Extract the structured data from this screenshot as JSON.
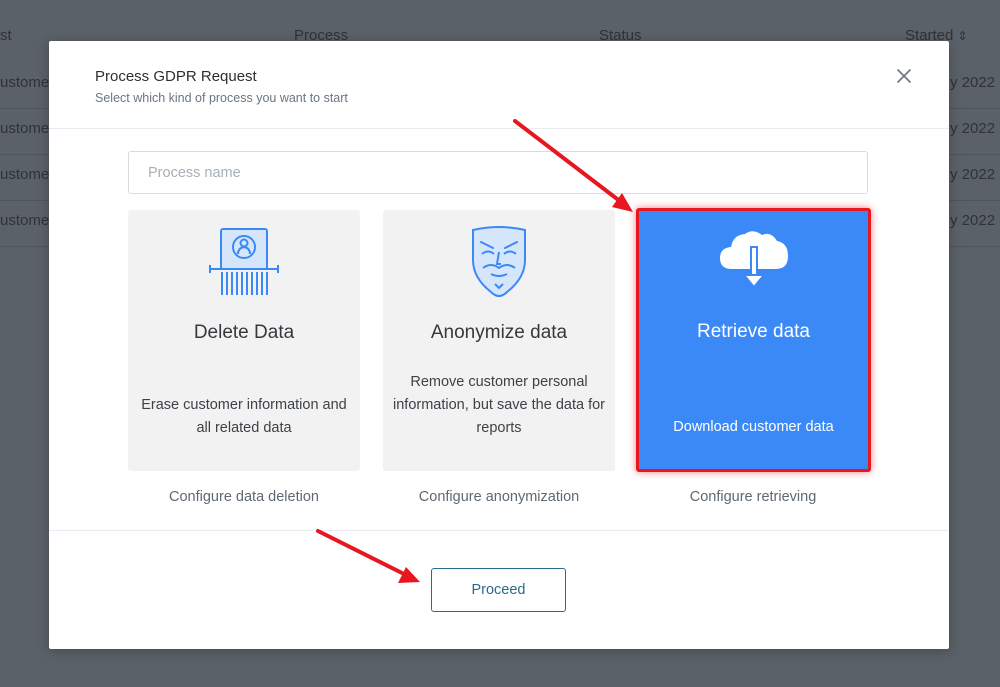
{
  "background_table": {
    "headers": [
      "st",
      "Process",
      "Status",
      "Started"
    ],
    "sort_icon": "sort-icon",
    "rows": [
      {
        "customer": "ustome",
        "started": "y 2022"
      },
      {
        "customer": "ustome",
        "started": "y 2022"
      },
      {
        "customer": "ustome",
        "started": "y 2022"
      },
      {
        "customer": "ustome",
        "started": "y 2022"
      }
    ]
  },
  "modal": {
    "title": "Process GDPR Request",
    "subtitle": "Select which kind of process you want to start",
    "close_icon": "close-icon",
    "name_input": {
      "value": "",
      "placeholder": "Process name"
    },
    "cards": [
      {
        "title": "Delete Data",
        "description": "Erase customer information and all related data",
        "configure": "Configure data deletion",
        "icon": "document-shredder-icon",
        "selected": false
      },
      {
        "title": "Anonymize data",
        "description": "Remove customer personal information, but save the data for reports",
        "configure": "Configure anonymization",
        "icon": "mask-icon",
        "selected": false
      },
      {
        "title": "Retrieve data",
        "description": "Download customer data",
        "configure": "Configure retrieving",
        "icon": "cloud-download-icon",
        "selected": true
      }
    ],
    "proceed_label": "Proceed"
  },
  "colors": {
    "accent_blue": "#3b89f7",
    "highlight_red": "#e8161e",
    "proceed_border": "#2b6b8c",
    "icon_blue": "#3b89f7"
  }
}
